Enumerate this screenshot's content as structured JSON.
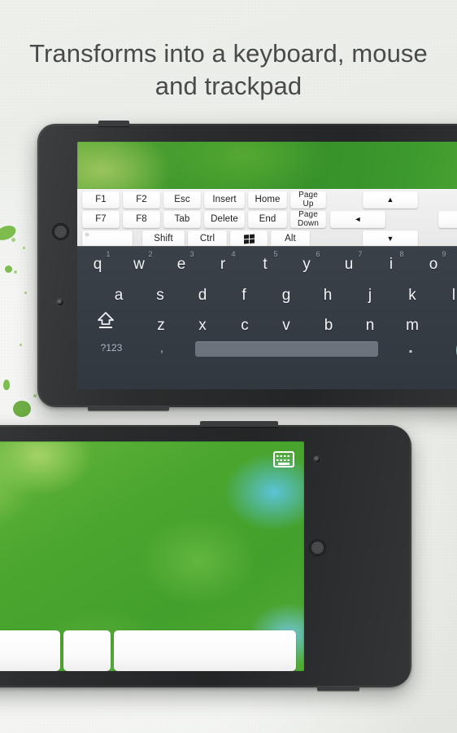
{
  "headline": {
    "line1": "Transforms into a keyboard, mouse",
    "line2": "and trackpad"
  },
  "colors": {
    "background": "#eceeea",
    "splatter_green": "#7cbd4e",
    "wallpaper_green": "#41992c",
    "keyboard_dark": "#363c44",
    "key_white": "#ffffff",
    "enter_teal": "#86cdbd",
    "phone_bezel": "#2b2d2e"
  },
  "top_device": {
    "status_icon": "keyboard-icon",
    "function_rows": [
      {
        "row": 1,
        "keys": [
          {
            "label": "F1",
            "type": "normal"
          },
          {
            "label": "F2",
            "type": "normal"
          },
          {
            "label": "Esc",
            "type": "normal"
          },
          {
            "label": "Insert",
            "type": "normal"
          },
          {
            "label": "Home",
            "type": "normal"
          },
          {
            "label": "Page\nUp",
            "type": "twoline"
          },
          {
            "label": "▲",
            "type": "arrow",
            "icon": "arrow-up-icon"
          }
        ]
      },
      {
        "row": 2,
        "keys": [
          {
            "label": "F7",
            "type": "normal"
          },
          {
            "label": "F8",
            "type": "normal"
          },
          {
            "label": "Tab",
            "type": "normal"
          },
          {
            "label": "Delete",
            "type": "normal"
          },
          {
            "label": "End",
            "type": "normal"
          },
          {
            "label": "Page\nDown",
            "type": "twoline"
          },
          {
            "label": "◄",
            "type": "arrow",
            "icon": "arrow-left-icon"
          },
          {
            "label": "",
            "type": "cutoff",
            "icon": "arrow-right-icon"
          }
        ]
      },
      {
        "row": 3,
        "keys": [
          {
            "label": "",
            "type": "blank"
          },
          {
            "label": "Shift",
            "type": "normal"
          },
          {
            "label": "Ctrl",
            "type": "normal"
          },
          {
            "label": "",
            "type": "windows",
            "icon": "windows-logo-icon"
          },
          {
            "label": "Alt",
            "type": "normal"
          },
          {
            "label": "▼",
            "type": "arrow",
            "icon": "arrow-down-icon"
          }
        ]
      }
    ],
    "soft_keyboard": {
      "row_top": [
        {
          "char": "q",
          "num": "1"
        },
        {
          "char": "w",
          "num": "2"
        },
        {
          "char": "e",
          "num": "3"
        },
        {
          "char": "r",
          "num": "4"
        },
        {
          "char": "t",
          "num": "5"
        },
        {
          "char": "y",
          "num": "6"
        },
        {
          "char": "u",
          "num": "7"
        },
        {
          "char": "i",
          "num": "8"
        },
        {
          "char": "o",
          "num": "9"
        }
      ],
      "row_home": [
        "a",
        "s",
        "d",
        "f",
        "g",
        "h",
        "j",
        "k",
        "l"
      ],
      "row_bottom": [
        "z",
        "x",
        "c",
        "v",
        "b",
        "n",
        "m"
      ],
      "shift_icon": "shift-arrow-icon",
      "symbols_key": "?123",
      "comma_key": ",",
      "period_key": ".",
      "space_key": "",
      "enter_key": ""
    }
  },
  "bottom_device": {
    "status_icon": "keyboard-icon",
    "trackpad_label": "",
    "mouse_buttons": [
      {
        "name": "left-mouse-button",
        "label": ""
      },
      {
        "name": "middle-mouse-button",
        "label": ""
      },
      {
        "name": "right-mouse-button",
        "label": ""
      }
    ]
  }
}
